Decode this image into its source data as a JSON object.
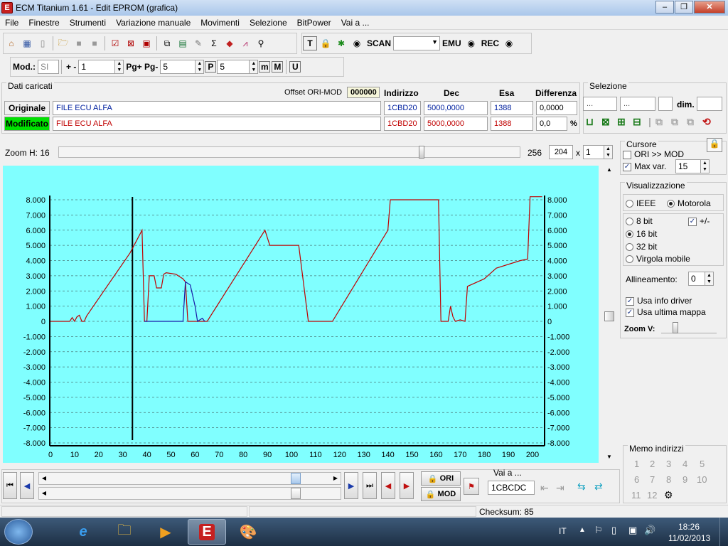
{
  "window": {
    "title": "ECM Titanium 1.61 - Edit EPROM (grafica)"
  },
  "menu": [
    "File",
    "Finestre",
    "Strumenti",
    "Variazione manuale",
    "Movimenti",
    "Selezione",
    "BitPower",
    "Vai a ..."
  ],
  "toolbar1": {
    "scan_label": "SCAN",
    "scan_value": "",
    "emu_label": "EMU",
    "rec_label": "REC"
  },
  "toolbar2": {
    "mod_label": "Mod.:",
    "mod_value": "SI",
    "plusminus_label": "+ -",
    "plusminus_value": "1",
    "pg_label": "Pg+ Pg-",
    "pg_value": "5",
    "p_value": "5",
    "p_icon": "P",
    "m_icon1": "m",
    "m_icon2": "M",
    "u_icon": "U"
  },
  "dati": {
    "title": "Dati caricati",
    "offset_label": "Offset ORI-MOD",
    "offset_value": "000000",
    "headers": {
      "indirizzo": "Indirizzo",
      "dec": "Dec",
      "esa": "Esa",
      "differenza": "Differenza"
    },
    "originale": {
      "label": "Originale",
      "file": "FILE ECU ALFA",
      "indirizzo": "1CBD20",
      "dec": "5000,0000",
      "esa": "1388",
      "differenza": "0,0000"
    },
    "modificato": {
      "label": "Modificato",
      "file": "FILE ECU ALFA",
      "indirizzo": "1CBD20",
      "dec": "5000,0000",
      "esa": "1388",
      "differenza": "0,0",
      "percent": "%"
    }
  },
  "selezione": {
    "title": "Selezione",
    "field1": "...",
    "field2": "...",
    "dim_label": "dim."
  },
  "zoom": {
    "label": "Zoom H: 16",
    "value1": "256",
    "value2": "204",
    "x_label": "x",
    "value3": "1",
    "fraction": 0.79
  },
  "cursore": {
    "title": "Cursore",
    "ori_mod_label": "ORI >> MOD",
    "max_var_label": "Max var.",
    "max_var_value": "15"
  },
  "visualizzazione": {
    "title": "Visualizzazione",
    "ieee": "IEEE",
    "motorola": "Motorola",
    "bit8": "8 bit",
    "bit16": "16 bit",
    "bit32": "32 bit",
    "virgola": "Virgola mobile",
    "plusminus": "+/-",
    "allineamento_label": "Allineamento:",
    "allineamento_value": "0",
    "usa_info": "Usa info driver",
    "usa_ultima": "Usa ultima mappa",
    "zoom_v_label": "Zoom V:"
  },
  "memo": {
    "title": "Memo indirizzi",
    "items": [
      "1",
      "2",
      "3",
      "4",
      "5",
      "6",
      "7",
      "8",
      "9",
      "10",
      "11",
      "12"
    ]
  },
  "bottom": {
    "ori_label": "ORI",
    "mod_label": "MOD",
    "vai_label": "Vai a ...",
    "vai_value": "1CBCDC"
  },
  "status": {
    "checksum": "Checksum: 85"
  },
  "taskbar": {
    "lang": "IT",
    "time": "18:26",
    "date": "11/02/2013"
  },
  "colors": {
    "chart_bg": "#80ffff",
    "modified_line": "#c00000",
    "original_line": "#1a1aa8",
    "cursor_line": "#000000",
    "modificato_bg": "#00e000"
  },
  "chart_data": {
    "type": "line",
    "xlim": [
      0,
      204
    ],
    "ylim": [
      -8000,
      8000
    ],
    "x_ticks": [
      0,
      10,
      20,
      30,
      40,
      50,
      60,
      70,
      80,
      90,
      100,
      110,
      120,
      130,
      140,
      150,
      160,
      170,
      180,
      190,
      200
    ],
    "y_ticks_left": [
      "8.000",
      "7.000",
      "6.000",
      "5.000",
      "4.000",
      "3.000",
      "2.000",
      "1.000",
      "0",
      "-1.000",
      "-2.000",
      "-3.000",
      "-4.000",
      "-5.000",
      "-6.000",
      "-7.000",
      "-8.000"
    ],
    "y_ticks_right": [
      "8.000",
      "7.000",
      "6.000",
      "5.000",
      "4.000",
      "3.000",
      "2.000",
      "1.000",
      "0",
      "-1.000",
      "-2.000",
      "-3.000",
      "-4.000",
      "-5.000",
      "-6.000",
      "-7.000",
      "-8.000"
    ],
    "y_tick_values": [
      8000,
      7000,
      6000,
      5000,
      4000,
      3000,
      2000,
      1000,
      0,
      -1000,
      -2000,
      -3000,
      -4000,
      -5000,
      -6000,
      -7000,
      -8000
    ],
    "grid": true,
    "cursor_x": 34,
    "series": [
      {
        "values": [
          [
            0,
            0
          ],
          [
            8,
            0
          ],
          [
            9,
            250
          ],
          [
            10,
            0
          ],
          [
            11,
            300
          ],
          [
            12,
            400
          ],
          [
            13,
            0
          ],
          [
            14,
            0
          ],
          [
            15,
            350
          ],
          [
            33,
            4500
          ],
          [
            38,
            6000
          ],
          [
            39,
            0
          ],
          [
            40,
            0
          ],
          [
            41,
            3000
          ],
          [
            43,
            3000
          ],
          [
            44,
            2200
          ],
          [
            46,
            2200
          ],
          [
            47,
            3100
          ],
          [
            48,
            3200
          ],
          [
            52,
            3100
          ],
          [
            55,
            2800
          ],
          [
            56,
            2600
          ],
          [
            57,
            0
          ],
          [
            62,
            0
          ],
          [
            65,
            0
          ],
          [
            89,
            6000
          ],
          [
            91,
            5000
          ],
          [
            103,
            5000
          ],
          [
            107,
            0
          ],
          [
            117,
            0
          ],
          [
            140,
            6000
          ],
          [
            141,
            8000
          ],
          [
            151,
            8000
          ],
          [
            161,
            8000
          ],
          [
            162,
            0
          ],
          [
            165,
            0
          ],
          [
            166,
            1000
          ],
          [
            167,
            300
          ],
          [
            168,
            0
          ],
          [
            170,
            100
          ],
          [
            172,
            0
          ],
          [
            173,
            2300
          ],
          [
            180,
            2800
          ],
          [
            185,
            3500
          ],
          [
            195,
            4000
          ],
          [
            198,
            4100
          ],
          [
            199,
            8200
          ],
          [
            204,
            8200
          ]
        ]
      },
      {
        "values": [
          [
            39,
            0
          ],
          [
            55,
            0
          ],
          [
            56,
            2600
          ],
          [
            58,
            2400
          ],
          [
            60,
            1000
          ],
          [
            61,
            0
          ],
          [
            63,
            200
          ],
          [
            64,
            0
          ]
        ]
      }
    ]
  }
}
